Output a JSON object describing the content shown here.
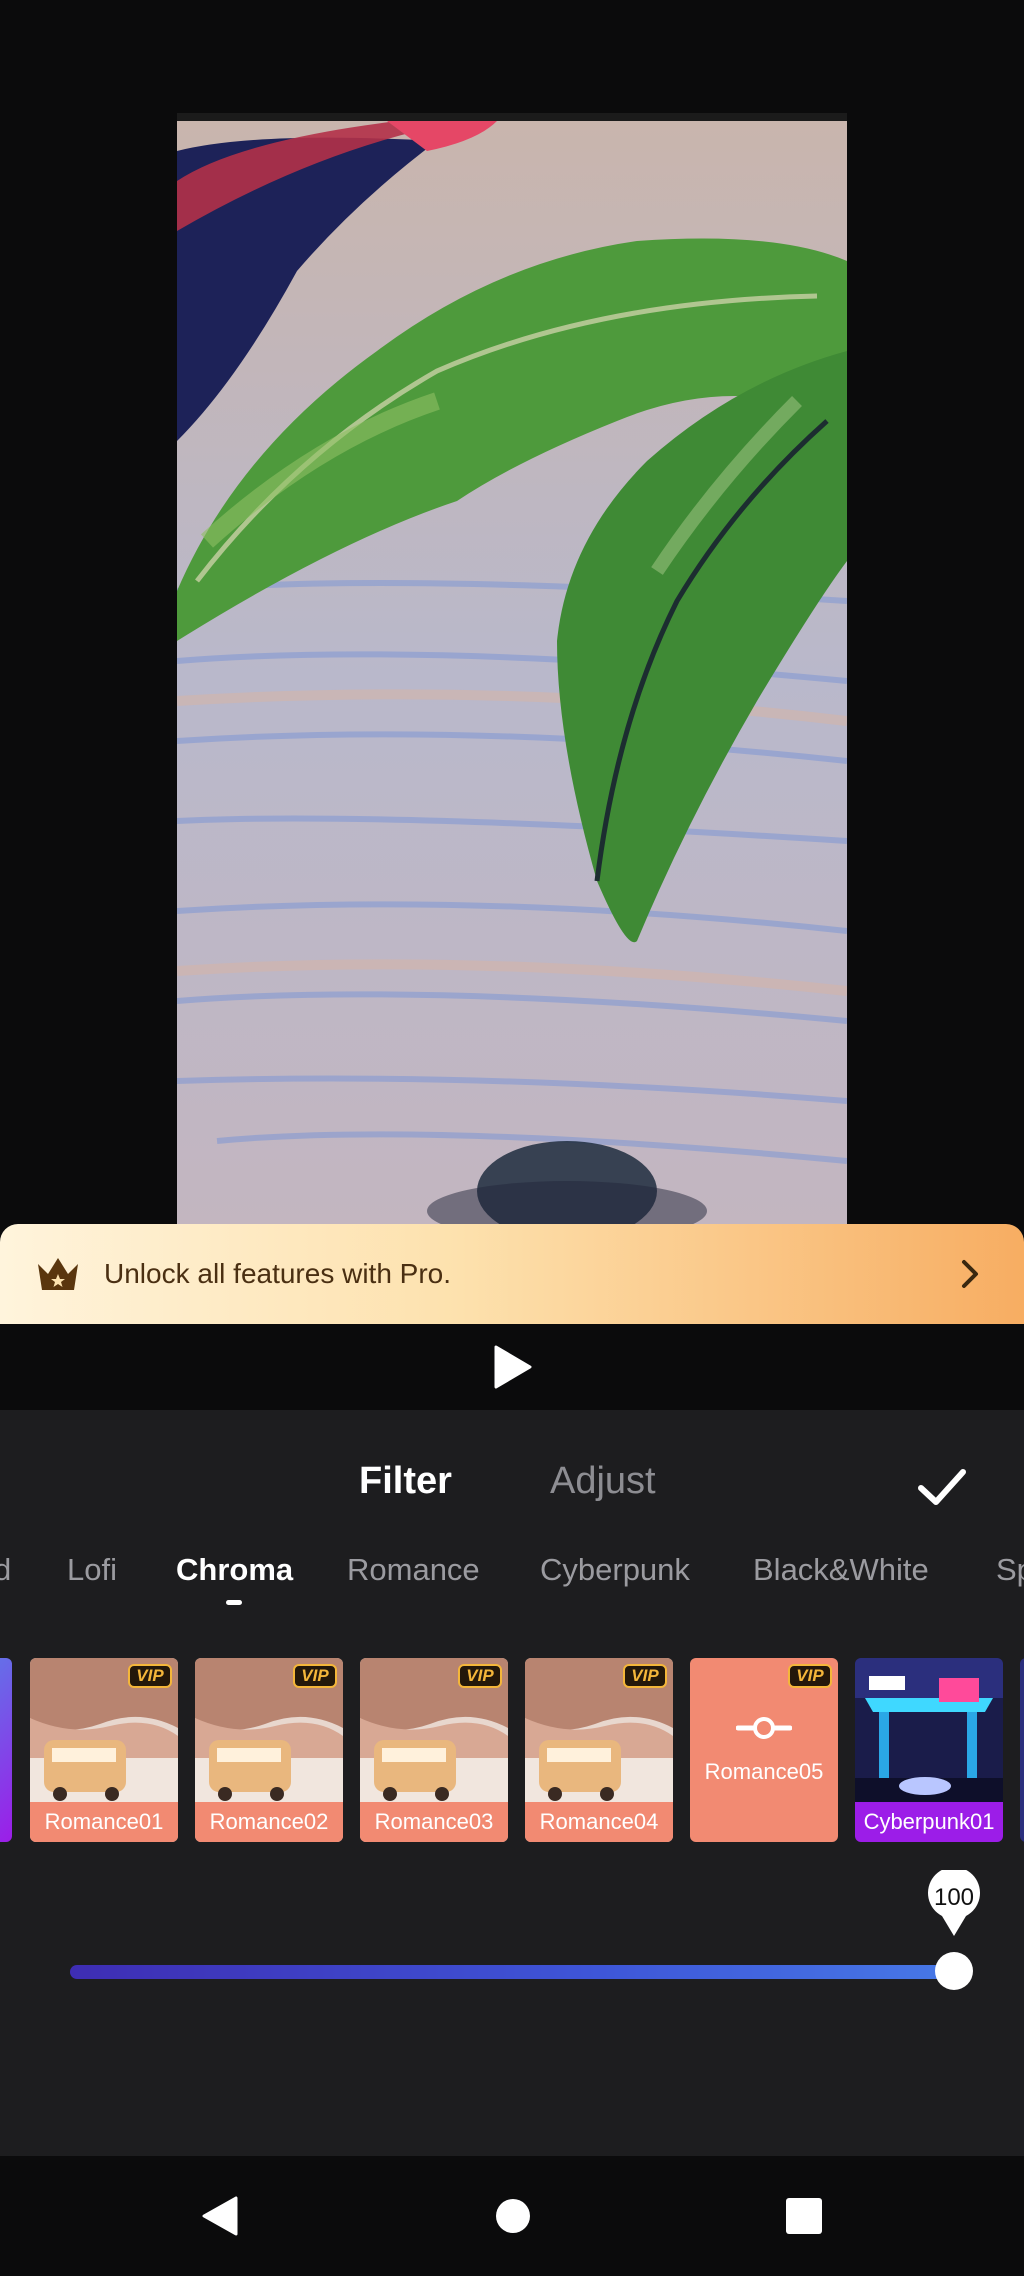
{
  "pro_banner": {
    "text": "Unlock all features with Pro."
  },
  "tabs": {
    "filter": "Filter",
    "adjust": "Adjust"
  },
  "categories": [
    {
      "label": "d"
    },
    {
      "label": "Lofi"
    },
    {
      "label": "Chroma"
    },
    {
      "label": "Romance"
    },
    {
      "label": "Cyberpunk"
    },
    {
      "label": "Black&White"
    },
    {
      "label": "Sp"
    }
  ],
  "active_category": "Chroma",
  "filters": [
    {
      "label": "Romance01",
      "vip": "VIP"
    },
    {
      "label": "Romance02",
      "vip": "VIP"
    },
    {
      "label": "Romance03",
      "vip": "VIP"
    },
    {
      "label": "Romance04",
      "vip": "VIP"
    },
    {
      "label": "Romance05",
      "vip": "VIP",
      "selected": true
    },
    {
      "label": "Cyberpunk01",
      "vip": ""
    }
  ],
  "slider": {
    "value": "100",
    "fraction": 1.0
  },
  "colors": {
    "accent_romance": "#f28a72",
    "accent_cyberpunk": "#9c1de8",
    "vip_gold": "#f4b63a",
    "slider_start": "#3e2db3",
    "slider_end": "#4778e6"
  },
  "icons": {
    "pro": "crown-icon",
    "banner_arrow": "chevron-right-icon",
    "play": "play-icon",
    "confirm": "checkmark-icon",
    "adjust_selected": "slider-adjust-icon",
    "nav": [
      "back-triangle-icon",
      "home-circle-icon",
      "recents-square-icon"
    ]
  }
}
